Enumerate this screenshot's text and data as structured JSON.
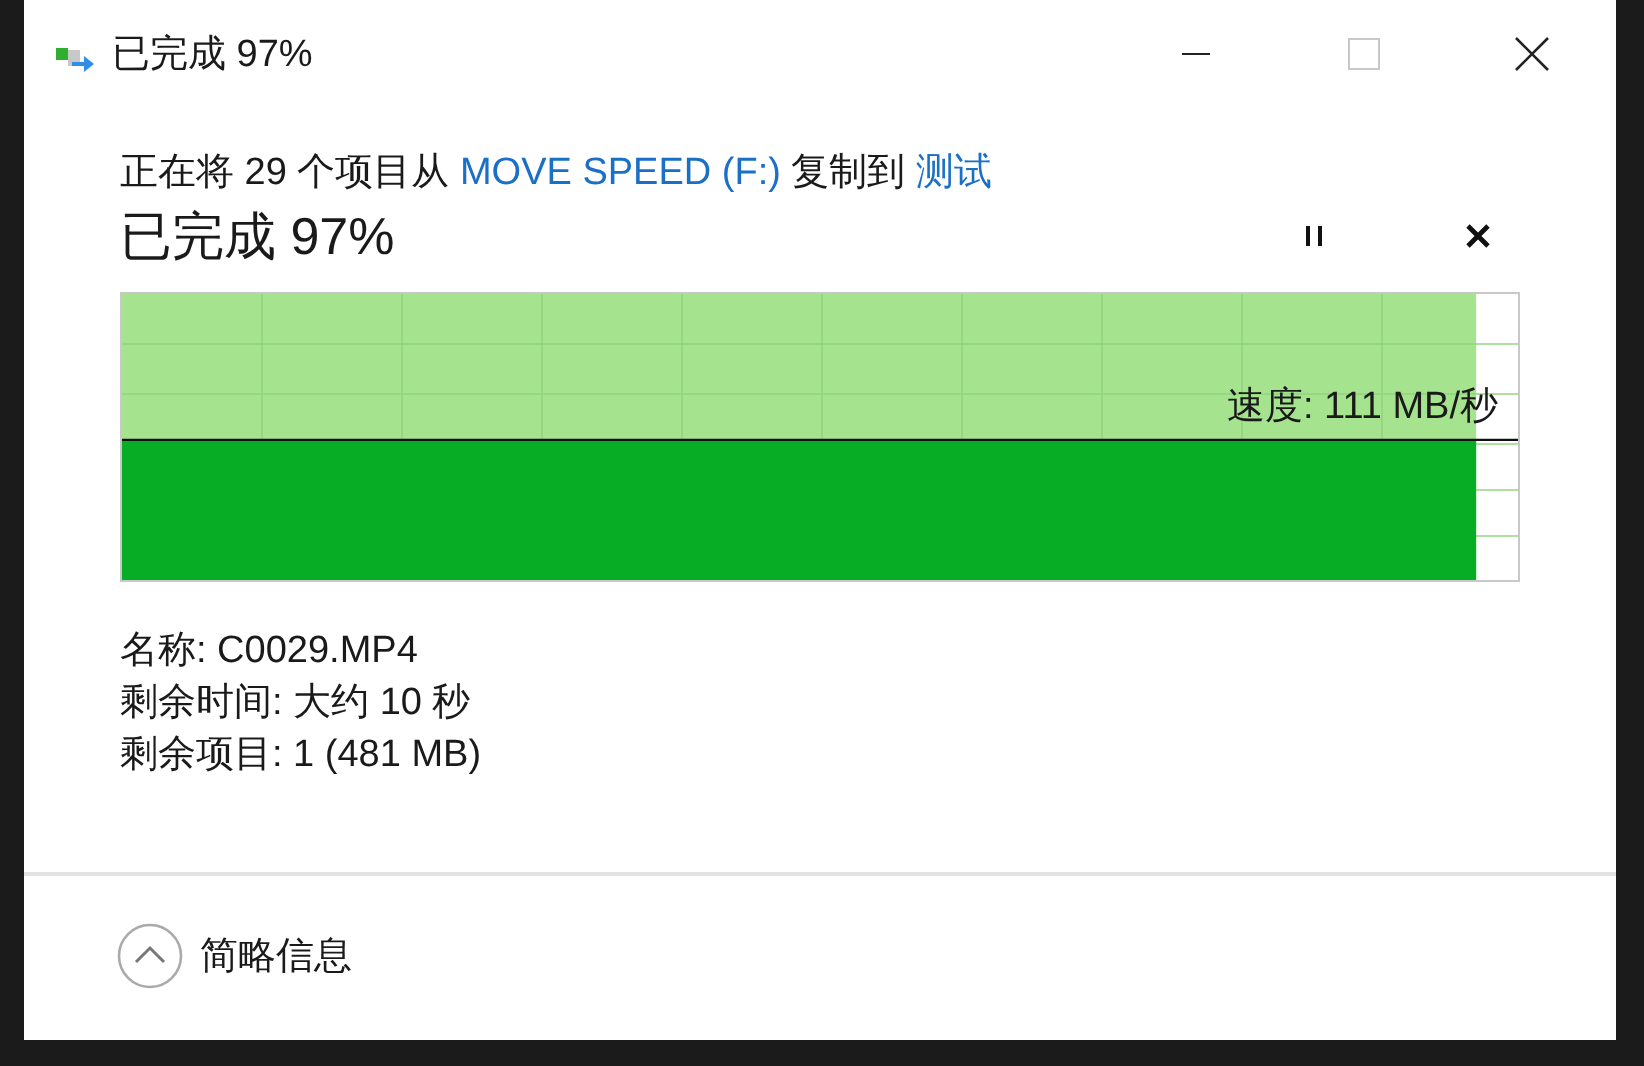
{
  "window": {
    "title": "已完成 97%"
  },
  "description": {
    "prefix": "正在将 29 个项目从",
    "source": "MOVE SPEED (F:)",
    "middle": "复制到",
    "destination": "测试"
  },
  "heading": "已完成 97%",
  "graph": {
    "level": 0.97,
    "speed": {
      "reading": "速度: 111 MB/秒"
    }
  },
  "details": [
    "名称: C0029.MP4",
    "剩余时间: 大约 10 秒",
    "剩余项目: 1 (481 MB)"
  ],
  "footer": {
    "toggle": "简略信息",
    "expanded": true
  }
}
